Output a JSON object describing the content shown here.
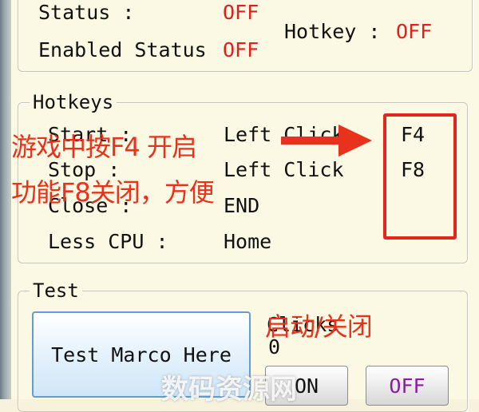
{
  "status": {
    "status_label": "Status :",
    "status_value": "OFF",
    "enabled_label": "Enabled Status",
    "enabled_value": "OFF",
    "hotkey_label": "Hotkey :",
    "hotkey_value": "OFF"
  },
  "hotkeys": {
    "title": "Hotkeys",
    "rows": [
      {
        "label": "Start :",
        "value": "Left Click",
        "key": "F4"
      },
      {
        "label": "Stop :",
        "value": "Left Click",
        "key": "F8"
      },
      {
        "label": "Close :",
        "value": "END"
      },
      {
        "label": "Less CPU :",
        "value": "Home"
      }
    ]
  },
  "test": {
    "title": "Test",
    "test_button": "Test Marco Here",
    "clicks_label": "Clicks",
    "clicks_value": "0",
    "on_button": "ON",
    "off_button": "OFF"
  },
  "annotations": {
    "line1": "游戏中按F4 开启",
    "line2": "功能F8关闭，方便",
    "line3": "启动/关闭"
  },
  "watermark": "数码资源网",
  "colors": {
    "off_red": "#e0201c",
    "annotation_red": "#e8321c",
    "off_button_text": "#8b1aa6",
    "background": "#fbf8e3"
  }
}
